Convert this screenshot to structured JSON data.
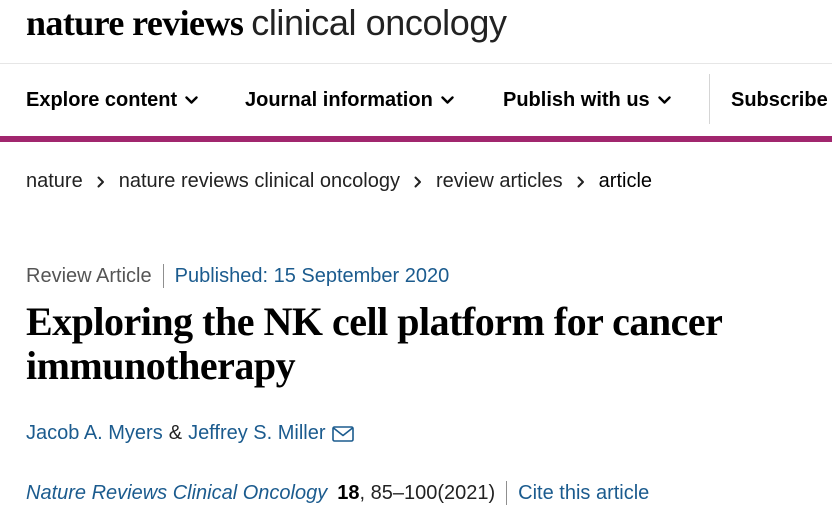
{
  "brand": {
    "bold": "nature reviews",
    "light": "clinical oncology"
  },
  "nav": {
    "items": [
      {
        "label": "Explore content",
        "has_dropdown": true
      },
      {
        "label": "Journal information",
        "has_dropdown": true
      },
      {
        "label": "Publish with us",
        "has_dropdown": true
      },
      {
        "label": "Subscribe",
        "has_dropdown": false
      }
    ]
  },
  "colors": {
    "accent": "#a1266e",
    "link": "#1b5b8e"
  },
  "breadcrumb": {
    "items": [
      "nature",
      "nature reviews clinical oncology",
      "review articles",
      "article"
    ]
  },
  "article": {
    "type": "Review Article",
    "published": "Published: 15 September 2020",
    "title": "Exploring the NK cell platform for cancer immunotherapy",
    "authors": [
      "Jacob A. Myers",
      "Jeffrey S. Miller"
    ],
    "author_joiner": "&",
    "email_icon": "mail-icon",
    "journal": "Nature Reviews Clinical Oncology",
    "volume": "18",
    "pages": ", 85–100(2021)",
    "cite_label": "Cite this article"
  }
}
